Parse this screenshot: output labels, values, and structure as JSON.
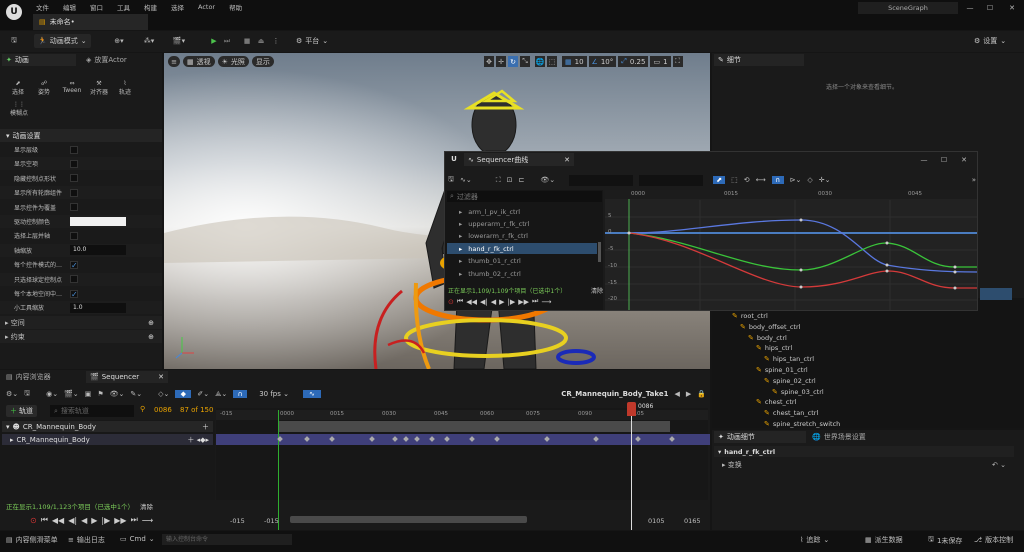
{
  "title_bar": {
    "logo": "unreal-logo",
    "menu": [
      "文件",
      "编辑",
      "窗口",
      "工具",
      "构建",
      "选择",
      "Actor",
      "帮助"
    ],
    "level_tab": "未命名•",
    "scenegraph": "SceneGraph"
  },
  "toolbar": {
    "mode": "动画模式",
    "platform": "平台",
    "settings": "设置"
  },
  "anim_panel": {
    "tab1": "动画",
    "tab2": "放置Actor",
    "tools": [
      "选择",
      "姿势",
      "Tween",
      "对齐器",
      "轨迹"
    ],
    "tool_extra": "模糊点",
    "section": "动画设置",
    "props": [
      {
        "label": "显示层级",
        "type": "check",
        "checked": false
      },
      {
        "label": "显示空项",
        "type": "check",
        "checked": false
      },
      {
        "label": "隐藏控制点形状",
        "type": "check",
        "checked": false
      },
      {
        "label": "显示所有轮廓组件",
        "type": "check",
        "checked": false
      },
      {
        "label": "显示控件为覆盖",
        "type": "check",
        "checked": false
      },
      {
        "label": "驱动控制颜色",
        "type": "color"
      },
      {
        "label": "选择上层并轴",
        "type": "check",
        "checked": false
      },
      {
        "label": "轴缩放",
        "type": "value",
        "value": "10.0"
      },
      {
        "label": "每个控件模式的…",
        "type": "check",
        "checked": true
      },
      {
        "label": "只选择球定控制点",
        "type": "check",
        "checked": false
      },
      {
        "label": "每个本地空间中…",
        "type": "check",
        "checked": true
      },
      {
        "label": "小工具缩放",
        "type": "value",
        "value": "1.0"
      }
    ],
    "sections": [
      "空间",
      "约束"
    ]
  },
  "viewport": {
    "perspective": "透视",
    "lit": "光照",
    "show": "显示",
    "grid_snap": "10",
    "rot_snap": "10°",
    "scale_snap": "0.25",
    "cam_speed": "1"
  },
  "curve_editor": {
    "title": "Sequencer曲线",
    "search_placeholder": "过滤器",
    "items": [
      "arm_l_pv_ik_ctrl",
      "upperarm_r_fk_ctrl",
      "lowerarm_r_fk_ctrl",
      "hand_r_fk_ctrl",
      "thumb_01_r_ctrl",
      "thumb_02_r_ctrl"
    ],
    "selected_index": 3,
    "status": "正在显示1,109/1,109个项目（已选中1个）",
    "clear": "清除",
    "ruler": [
      "0000",
      "0015",
      "0030",
      "0045"
    ],
    "y_labels": [
      "5",
      "0",
      "-5",
      "-10",
      "-15",
      "-20"
    ]
  },
  "details": {
    "tab": "细节",
    "hint": "选择一个对象来查看细节。"
  },
  "outliner": {
    "rows": [
      {
        "label": "root_ctrl",
        "indent": 0
      },
      {
        "label": "body_offset_ctrl",
        "indent": 1
      },
      {
        "label": "body_ctrl",
        "indent": 2
      },
      {
        "label": "hips_ctrl",
        "indent": 3
      },
      {
        "label": "hips_tan_ctrl",
        "indent": 4
      },
      {
        "label": "spine_01_ctrl",
        "indent": 3
      },
      {
        "label": "spine_02_ctrl",
        "indent": 4
      },
      {
        "label": "spine_03_ctrl",
        "indent": 5
      },
      {
        "label": "chest_ctrl",
        "indent": 3
      },
      {
        "label": "chest_tan_ctrl",
        "indent": 4
      },
      {
        "label": "spine_stretch_switch",
        "indent": 4
      }
    ]
  },
  "anim_details": {
    "tab1": "动画细节",
    "tab2": "世界场景设置",
    "control": "hand_r_fk_ctrl",
    "section": "变换"
  },
  "sequencer": {
    "tab1": "内容浏览器",
    "tab2": "Sequencer",
    "fps": "30 fps",
    "sequence_name": "CR_Mannequin_Body_Take1",
    "add_track": "轨道",
    "search_placeholder": "搜索轨道",
    "current_frame": "0086",
    "frame_count": "87 of 150",
    "tracks": [
      "CR_Mannequin_Body",
      "CR_Mannequin_Body"
    ],
    "ruler": [
      "-015",
      "0000",
      "0015",
      "0030",
      "0045",
      "0060",
      "0075",
      "0090",
      "0105"
    ],
    "playhead": "0086",
    "status": "正在显示1,109/1,123个项目（已选中1个）",
    "clear": "清除",
    "bottom_left": [
      "-015",
      "-015"
    ],
    "bottom_right": [
      "0105",
      "0165"
    ]
  },
  "status_bar": {
    "drawer": "内容侧滑菜单",
    "output": "输出日志",
    "cmd": "Cmd",
    "cmd_placeholder": "输入控制台命令",
    "trace": "追踪",
    "derived": "派生数据",
    "unsaved": "1未保存",
    "source": "版本控制"
  }
}
